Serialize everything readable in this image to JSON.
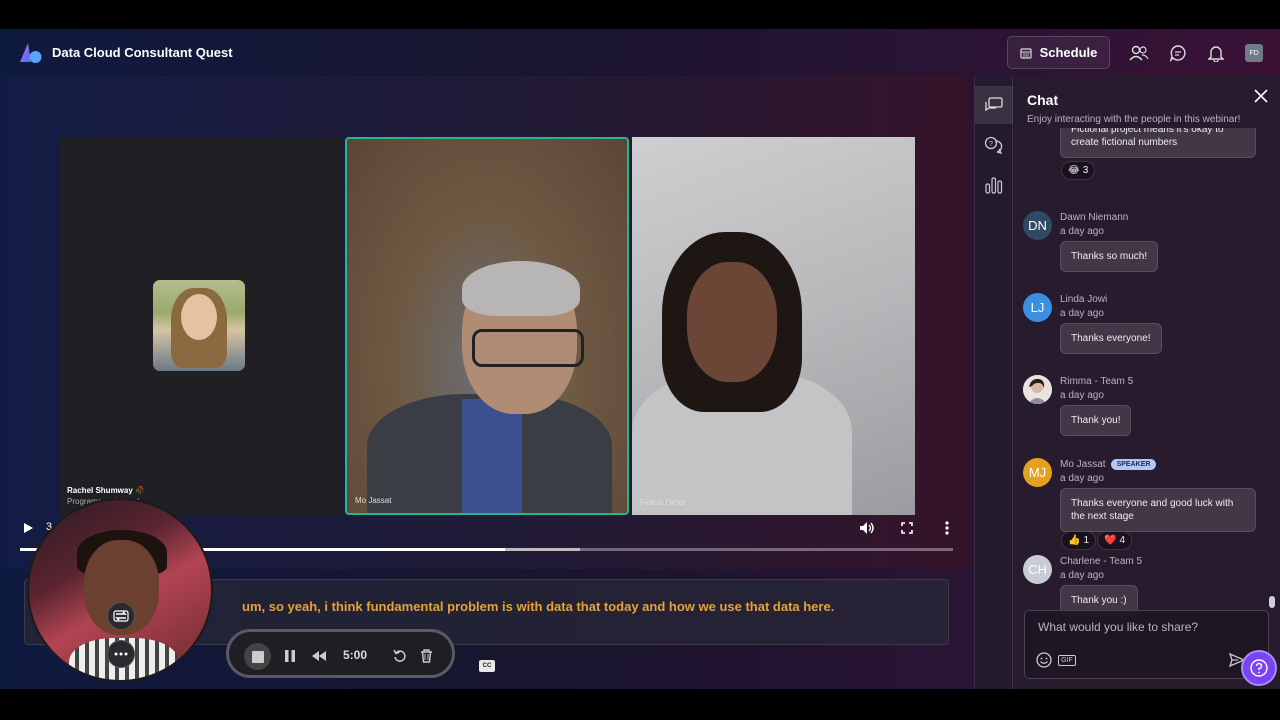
{
  "header": {
    "app_title": "Data Cloud Consultant Quest",
    "schedule_label": "Schedule",
    "user_initials": "FD"
  },
  "stage": {
    "tiles": [
      {
        "name": "Rachel Shumway 🥀",
        "subline": "Programs ... Clicked"
      },
      {
        "name": "Mo Jassat"
      },
      {
        "name": "Felicia Dicks"
      }
    ],
    "progress": {
      "played_fraction": 0.52,
      "buffered_fraction": 0.6
    },
    "time_fragment": "3"
  },
  "caption": {
    "text": "um, so yeah, i think fundamental problem is with data that today and how we use that data here."
  },
  "recorder": {
    "time": "5:00",
    "cc_label": "CC"
  },
  "chat": {
    "title": "Chat",
    "subtitle": "Enjoy interacting with the people in this webinar!",
    "partial_message": {
      "text": "Fictional project means it's okay to create fictional numbers",
      "reaction_emoji": "😂",
      "reaction_count": "3"
    },
    "messages": [
      {
        "initials": "DN",
        "avatar_color": "#2f4a63",
        "name": "Dawn Niemann",
        "time": "a day ago",
        "text": "Thanks so much!"
      },
      {
        "initials": "LJ",
        "avatar_color": "#3b8ee0",
        "name": "Linda Jowi",
        "time": "a day ago",
        "text": "Thanks everyone!"
      },
      {
        "initials": "",
        "avatar_color": "#d9c7c0",
        "name": "Rimma - Team 5",
        "time": "a day ago",
        "text": "Thank you!"
      },
      {
        "initials": "MJ",
        "avatar_color": "#e6a020",
        "name": "Mo Jassat",
        "badge": "SPEAKER",
        "time": "a day ago",
        "text": "Thanks everyone and good luck with the next stage",
        "reactions": [
          {
            "emoji": "👍",
            "count": "1"
          },
          {
            "emoji": "❤️",
            "count": "4"
          }
        ]
      },
      {
        "initials": "CH",
        "avatar_color": "#c9ccd3",
        "name": "Charlene - Team 5",
        "time": "a day ago",
        "text": "Thank you :)"
      }
    ],
    "composer_placeholder": "What would you like to share?",
    "gif_label": "GIF"
  }
}
